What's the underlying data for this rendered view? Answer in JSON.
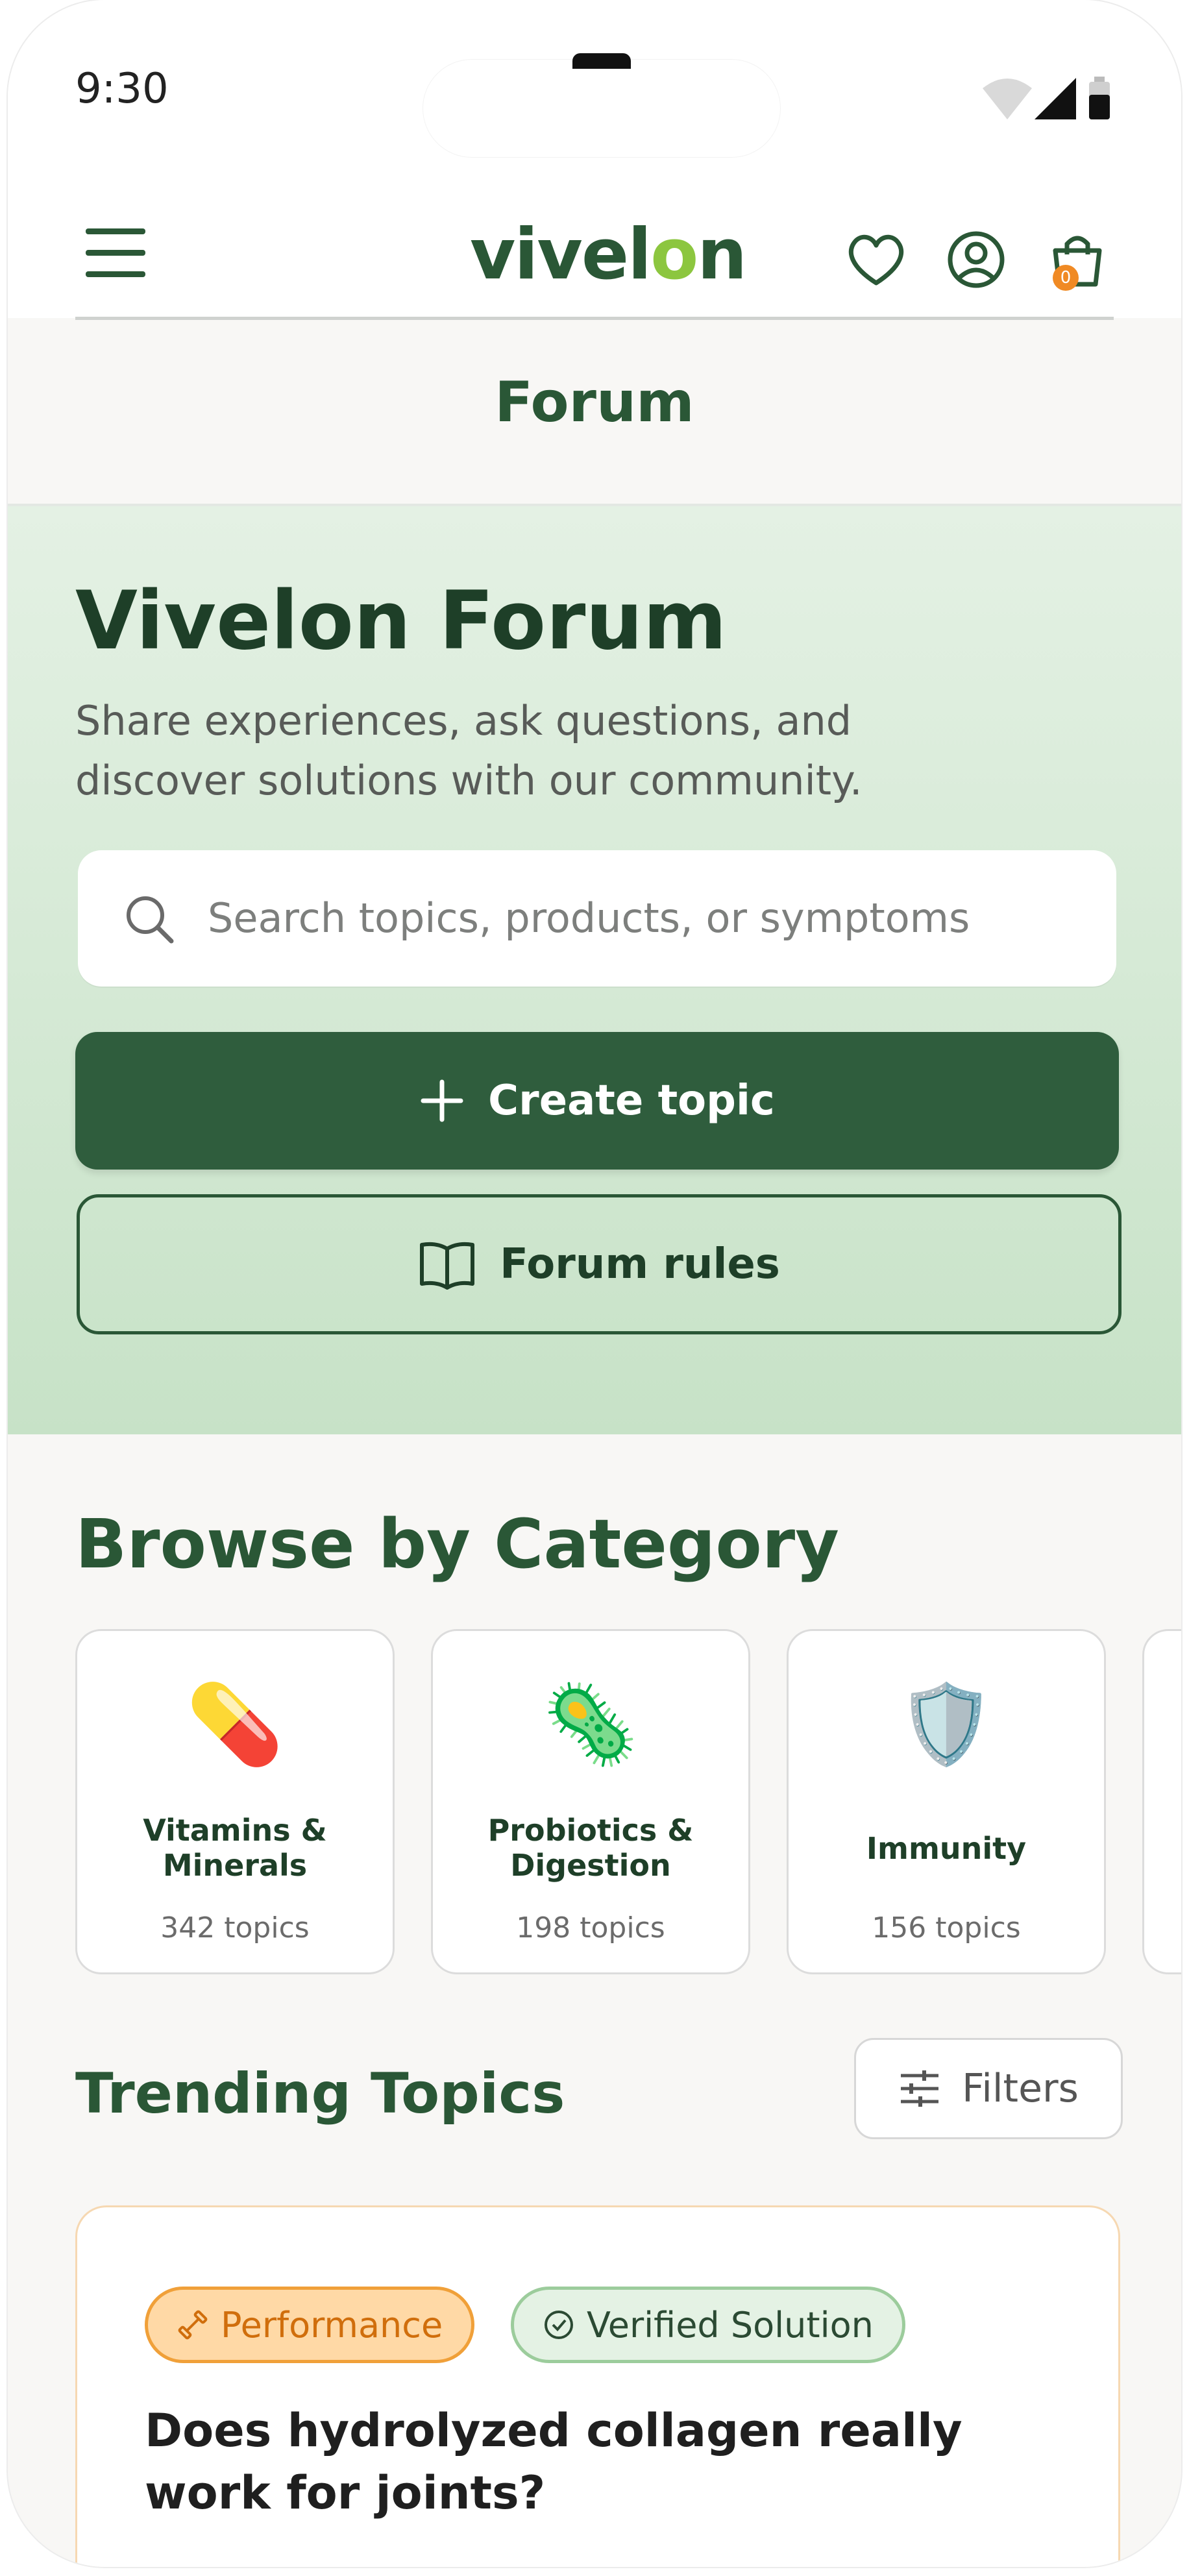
{
  "status_bar": {
    "time": "9:30"
  },
  "header": {
    "logo_text_a": "vivel",
    "logo_text_o": "o",
    "logo_text_b": "n",
    "cart_count": "0",
    "page_title": "Forum"
  },
  "hero": {
    "title": "Vivelon Forum",
    "subtitle": "Share experiences, ask questions, and discover solutions with our community.",
    "search_placeholder": "Search topics, products, or symptoms",
    "create_label": "Create topic",
    "rules_label": "Forum rules"
  },
  "categories": {
    "title": "Browse by Category",
    "items": [
      {
        "icon": "pill-icon",
        "emoji": "💊",
        "name": "Vitamins & Minerals",
        "count": "342 topics"
      },
      {
        "icon": "microbe-icon",
        "emoji": "🦠",
        "name": "Probiotics & Digestion",
        "count": "198 topics"
      },
      {
        "icon": "shield-icon",
        "emoji": "🛡️",
        "name": "Immunity",
        "count": "156 topics"
      }
    ]
  },
  "trending": {
    "title": "Trending Topics",
    "filters_label": "Filters",
    "topic": {
      "tag_category": "Performance",
      "tag_status": "Verified Solution",
      "title": "Does hydrolyzed collagen really work for joints?"
    }
  },
  "colors": {
    "brand_green": "#2a5736",
    "accent_lime": "#8cc63f",
    "badge_orange": "#f08a24"
  }
}
